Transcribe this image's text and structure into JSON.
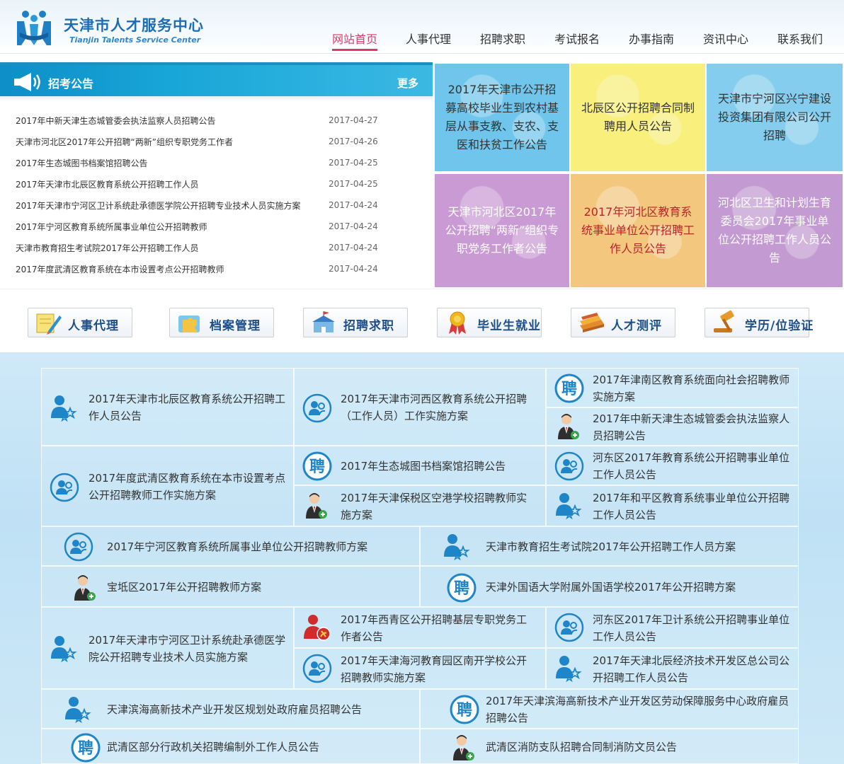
{
  "site": {
    "title_cn": "天津市人才服务中心",
    "title_en": "Tianjin Talents Service Center"
  },
  "nav": [
    {
      "label": "网站首页",
      "active": true
    },
    {
      "label": "人事代理"
    },
    {
      "label": "招聘求职"
    },
    {
      "label": "考试报名"
    },
    {
      "label": "办事指南"
    },
    {
      "label": "资讯中心"
    },
    {
      "label": "联系我们"
    }
  ],
  "announcements": {
    "title": "招考公告",
    "more": "更多",
    "items": [
      {
        "title": "2017年中新天津生态城管委会执法监察人员招聘公告",
        "date": "2017-04-27"
      },
      {
        "title": "天津市河北区2017年公开招聘“两新”组织专职党务工作者",
        "date": "2017-04-26"
      },
      {
        "title": "2017年生态城图书档案馆招聘公告",
        "date": "2017-04-25"
      },
      {
        "title": "2017年天津市北辰区教育系统公开招聘工作人员",
        "date": "2017-04-25"
      },
      {
        "title": "2017年天津市宁河区卫计系统赴承德医学院公开招聘专业技术人员实施方案",
        "date": "2017-04-24"
      },
      {
        "title": "2017年宁河区教育系统所属事业单位公开招聘教师",
        "date": "2017-04-24"
      },
      {
        "title": "天津市教育招生考试院2017年公开招聘工作人员",
        "date": "2017-04-24"
      },
      {
        "title": "2017年度武清区教育系统在本市设置考点公开招聘教师",
        "date": "2017-04-24"
      }
    ]
  },
  "tiles": [
    {
      "text": "2017年天津市公开招募高校毕业生到农村基层从事支教、支农、支医和扶贫工作公告",
      "color": "#6fc5ec",
      "text_color": "#333333"
    },
    {
      "text": "北辰区公开招聘合同制聘用人员公告",
      "color": "#f8ef7c",
      "text_color": "#333333"
    },
    {
      "text": "天津市宁河区兴宁建设投资集团有限公司公开招聘",
      "color": "#84cdee",
      "text_color": "#333333"
    },
    {
      "text": "天津市河北区2017年公开招聘“两新”组织专职党务工作者公告",
      "color": "#c99ad4",
      "text_color": "#ffffff"
    },
    {
      "text": "2017年河北区教育系统事业单位公开招聘工作人员公告",
      "color": "#f3c77e",
      "text_color": "#b8262c"
    },
    {
      "text": "河北区卫生和计划生育委员会2017年事业单位公开招聘工作人员公告",
      "color": "#c39ad2",
      "text_color": "#ffffff"
    }
  ],
  "services": [
    {
      "label": "人事代理",
      "icon": "document-pencil-icon"
    },
    {
      "label": "档案管理",
      "icon": "puzzle-folder-icon"
    },
    {
      "label": "招聘求职",
      "icon": "school-flag-icon"
    },
    {
      "label": "毕业生就业",
      "icon": "medal-ribbon-icon"
    },
    {
      "label": "人才测评",
      "icon": "books-icon"
    },
    {
      "label": "学历/位验证",
      "icon": "gavel-icon"
    }
  ],
  "grid": [
    {
      "text": "2017年天津市北辰区教育系统公开招聘工作人员公告",
      "icon": "people-star-icon"
    },
    {
      "text": "2017年天津市河西区教育系统公开招聘（工作人员）工作实施方案",
      "icon": "people-circle-icon"
    },
    {
      "text": "2017年津南区教育系统面向社会招聘教师实施方案",
      "icon": "pin-char-icon"
    },
    {
      "text": "2017年中新天津生态城管委会执法监察人员招聘公告",
      "icon": "businessman-icon"
    },
    {
      "text": "2017年度武清区教育系统在本市设置考点公开招聘教师工作实施方案",
      "icon": "people-circle-icon"
    },
    {
      "text": "2017年生态城图书档案馆招聘公告",
      "icon": "pin-char-icon"
    },
    {
      "text": "河东区2017年教育系统公开招聘事业单位工作人员公告",
      "icon": "people-circle-icon"
    },
    {
      "text": "2017年天津保税区空港学校招聘教师实施方案",
      "icon": "businessman-icon"
    },
    {
      "text": "2017年和平区教育系统事业单位公开招聘工作人员公告",
      "icon": "people-star-icon"
    },
    {
      "text": "2017年宁河区教育系统所属事业单位公开招聘教师方案",
      "icon": "people-circle-icon"
    },
    {
      "text": "天津市教育招生考试院2017年公开招聘工作人员方案",
      "icon": "people-star-icon"
    },
    {
      "text": "宝坻区2017年公开招聘教师方案",
      "icon": "businessman-icon"
    },
    {
      "text": "天津外国语大学附属外国语学校2017年公开招聘方案",
      "icon": "pin-char-icon"
    },
    {
      "text": "2017年天津市宁河区卫计系统赴承德医学院公开招聘专业技术人员实施方案",
      "icon": "people-star-icon"
    },
    {
      "text": "2017年西青区公开招聘基层专职党务工作者公告",
      "icon": "party-member-icon"
    },
    {
      "text": "河东区2017年卫计系统公开招聘事业单位工作人员公告",
      "icon": "people-circle-icon"
    },
    {
      "text": "2017年天津海河教育园区南开学校公开招聘教师实施方案",
      "icon": "people-circle-icon"
    },
    {
      "text": "2017年天津北辰经济技术开发区总公司公开招聘工作人员公告",
      "icon": "people-star-icon"
    },
    {
      "text": "天津滨海高新技术产业开发区规划处政府雇员招聘公告",
      "icon": "people-star-icon"
    },
    {
      "text": "2017年天津滨海高新技术产业开发区劳动保障服务中心政府雇员招聘公告",
      "icon": "pin-char-icon"
    },
    {
      "text": "武清区部分行政机关招聘编制外工作人员公告",
      "icon": "pin-char-icon"
    },
    {
      "text": "武清区消防支队招聘合同制消防文员公告",
      "icon": "businessman-icon"
    }
  ],
  "pin_char": "聘",
  "colors": {
    "accent": "#d83d6a",
    "brand": "#1c6db5",
    "icon_blue": "#1f85c9"
  }
}
